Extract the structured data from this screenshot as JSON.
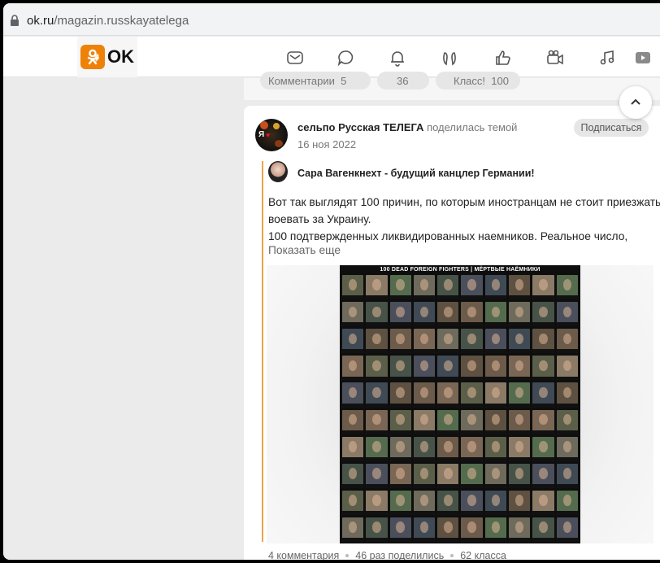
{
  "browser": {
    "url_domain": "ok.ru",
    "url_path": "/magazin.russkayatelega"
  },
  "header": {
    "logo_text": "OK",
    "nav_icons": [
      "mail-icon",
      "chat-icon",
      "bell-icon",
      "guests-icon",
      "like-icon",
      "video-icon",
      "music-icon",
      "play-icon"
    ]
  },
  "prev_post": {
    "comments_label": "Комментарии",
    "comments_count": "5",
    "shares_count": "36",
    "likes_label": "Класс!",
    "likes_count": "100"
  },
  "post": {
    "author_name": "сельпо Русская ТЕЛЕГА",
    "author_action": "поделилась темой",
    "date": "16 ноя 2022",
    "subscribe_label": "Подписаться",
    "shared_author": "Сара Вагенкнехт - будущий канцлер Германии!",
    "text_lines": [
      "Вот так выглядят 100 причин, по которым иностранцам не стоит приезжать",
      "воевать за Украину.",
      "100 подтвержденных    ликвидированных наемников. Реальное число,"
    ],
    "show_more": "Показать еще",
    "image_title": "100 DEAD FOREIGN FIGHTERS | МЁРТВЫЕ НАЁМНИКИ",
    "stats": {
      "comments": "4 комментария",
      "shares": "46 раз поделились",
      "likes": "62 класса"
    }
  },
  "colors": {
    "ok_orange": "#ee8208",
    "quote_bar": "#f2a24a",
    "page_bg": "#ebebeb"
  }
}
